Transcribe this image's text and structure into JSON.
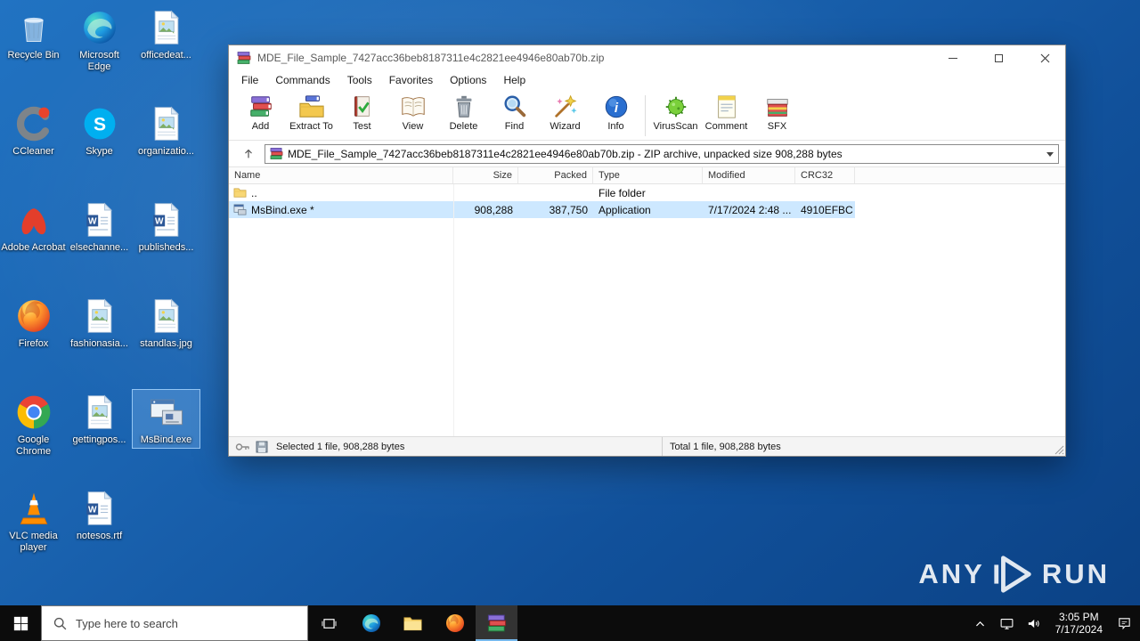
{
  "desktop": {
    "icons": [
      {
        "label": "Recycle Bin"
      },
      {
        "label": "CCleaner"
      },
      {
        "label": "Adobe Acrobat"
      },
      {
        "label": "Firefox"
      },
      {
        "label": "Google Chrome"
      },
      {
        "label": "VLC media player"
      },
      {
        "label": "Microsoft Edge"
      },
      {
        "label": "Skype"
      },
      {
        "label": "elsechanne..."
      },
      {
        "label": "fashionasia..."
      },
      {
        "label": "gettingpos..."
      },
      {
        "label": "notesos.rtf"
      },
      {
        "label": "officedeat..."
      },
      {
        "label": "organizatio..."
      },
      {
        "label": "publisheds..."
      },
      {
        "label": "standlas.jpg"
      },
      {
        "label": "MsBind.exe"
      }
    ]
  },
  "winrar": {
    "title": "MDE_File_Sample_7427acc36beb8187311e4c2821ee4946e80ab70b.zip",
    "menu": [
      "File",
      "Commands",
      "Tools",
      "Favorites",
      "Options",
      "Help"
    ],
    "toolbar": [
      "Add",
      "Extract To",
      "Test",
      "View",
      "Delete",
      "Find",
      "Wizard",
      "Info",
      "VirusScan",
      "Comment",
      "SFX"
    ],
    "address": "MDE_File_Sample_7427acc36beb8187311e4c2821ee4946e80ab70b.zip - ZIP archive, unpacked size 908,288 bytes",
    "columns": [
      "Name",
      "Size",
      "Packed",
      "Type",
      "Modified",
      "CRC32"
    ],
    "rows": [
      {
        "name": "..",
        "size": "",
        "packed": "",
        "type": "File folder",
        "modified": "",
        "crc32": ""
      },
      {
        "name": "MsBind.exe *",
        "size": "908,288",
        "packed": "387,750",
        "type": "Application",
        "modified": "7/17/2024 2:48 ...",
        "crc32": "4910EFBC"
      }
    ],
    "status": {
      "left": "Selected 1 file, 908,288 bytes",
      "right": "Total 1 file, 908,288 bytes"
    }
  },
  "taskbar": {
    "search_placeholder": "Type here to search",
    "time": "3:05 PM",
    "date": "7/17/2024"
  },
  "watermark": {
    "any": "ANY",
    "run": "RUN"
  },
  "colors": {
    "selection": "#cde8ff",
    "taskbar": "#0c0c0c",
    "accent": "#76b9ed"
  }
}
